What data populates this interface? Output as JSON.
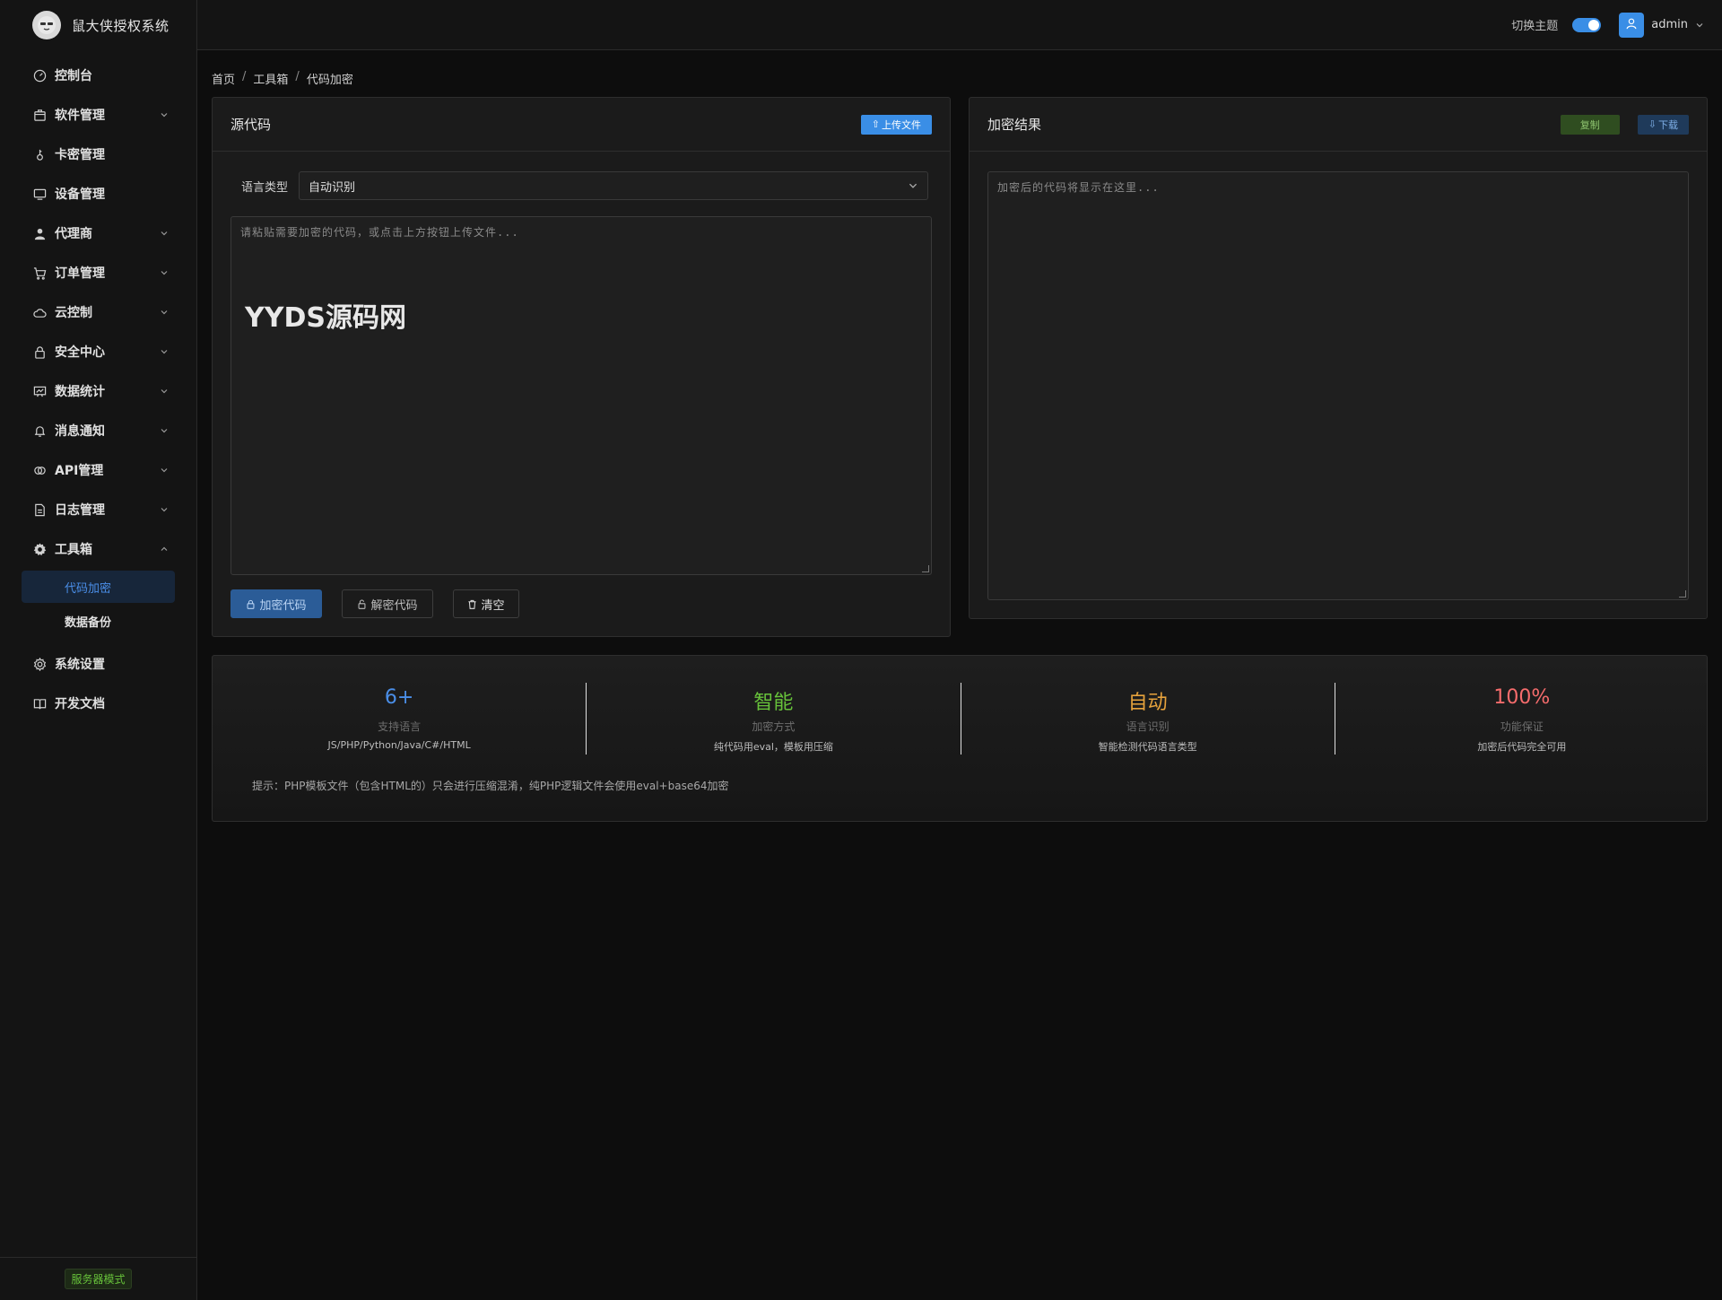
{
  "app": {
    "name": "鼠大侠授权系统"
  },
  "sidebar": {
    "items": [
      {
        "label": "控制台",
        "icon": "dashboard-icon",
        "has_chevron": false
      },
      {
        "label": "软件管理",
        "icon": "box-icon",
        "has_chevron": true
      },
      {
        "label": "卡密管理",
        "icon": "key-icon",
        "has_chevron": false
      },
      {
        "label": "设备管理",
        "icon": "monitor-icon",
        "has_chevron": false
      },
      {
        "label": "代理商",
        "icon": "user-icon",
        "has_chevron": true
      },
      {
        "label": "订单管理",
        "icon": "cart-icon",
        "has_chevron": true
      },
      {
        "label": "云控制",
        "icon": "cloud-icon",
        "has_chevron": true
      },
      {
        "label": "安全中心",
        "icon": "lock-icon",
        "has_chevron": true
      },
      {
        "label": "数据统计",
        "icon": "chart-icon",
        "has_chevron": true
      },
      {
        "label": "消息通知",
        "icon": "bell-icon",
        "has_chevron": true
      },
      {
        "label": "API管理",
        "icon": "api-icon",
        "has_chevron": true
      },
      {
        "label": "日志管理",
        "icon": "document-icon",
        "has_chevron": true
      },
      {
        "label": "工具箱",
        "icon": "gear-icon",
        "has_chevron": true,
        "expanded": true
      }
    ],
    "toolbox_sub": [
      {
        "label": "代码加密",
        "active": true
      },
      {
        "label": "数据备份",
        "active": false
      }
    ],
    "bottom_items": [
      {
        "label": "系统设置",
        "icon": "settings-icon"
      },
      {
        "label": "开发文档",
        "icon": "book-icon"
      }
    ],
    "footer_tag": "服务器模式"
  },
  "header": {
    "theme_label": "切换主题",
    "theme_dark": true,
    "user_name": "admin"
  },
  "breadcrumb": [
    "首页",
    "工具箱",
    "代码加密"
  ],
  "source_panel": {
    "title": "源代码",
    "upload_label": "上传文件",
    "lang_label": "语言类型",
    "lang_value": "自动识别",
    "placeholder": "请粘贴需要加密的代码，或点击上方按钮上传文件...",
    "watermark": "YYDS源码网",
    "encrypt_label": "加密代码",
    "decrypt_label": "解密代码",
    "clear_label": "清空"
  },
  "result_panel": {
    "title": "加密结果",
    "copy_label": "复制",
    "download_label": "下载",
    "placeholder": "加密后的代码将显示在这里..."
  },
  "stats": [
    {
      "value": "6+",
      "label": "支持语言",
      "desc": "JS/PHP/Python/Java/C#/HTML",
      "color": "#4a8ee8"
    },
    {
      "value": "智能",
      "label": "加密方式",
      "desc": "纯代码用eval，模板用压缩",
      "color": "#67c23a"
    },
    {
      "value": "自动",
      "label": "语言识别",
      "desc": "智能检测代码语言类型",
      "color": "#e6a23c"
    },
    {
      "value": "100%",
      "label": "功能保证",
      "desc": "加密后代码完全可用",
      "color": "#f56c6c"
    }
  ],
  "tip": "提示：PHP模板文件（包含HTML的）只会进行压缩混淆，纯PHP逻辑文件会使用eval+base64加密"
}
